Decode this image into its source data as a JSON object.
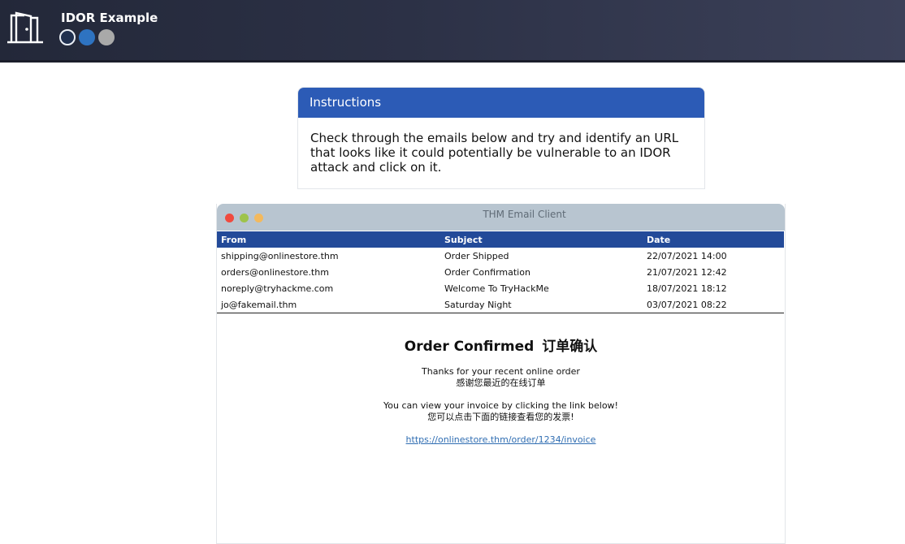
{
  "header": {
    "title": "IDOR Example",
    "logo_icon": "door-icon",
    "progress_dots": [
      "current",
      "active",
      "inactive"
    ]
  },
  "instructions": {
    "heading": "Instructions",
    "body": "Check through the emails below and try and identify an URL that looks like it could potentially be vulnerable to an IDOR attack and click on it."
  },
  "email_client": {
    "window_title": "THM Email Client",
    "columns": [
      "From",
      "Subject",
      "Date"
    ],
    "emails": [
      {
        "from": "shipping@onlinestore.thm",
        "subject": "Order Shipped",
        "date": "22/07/2021 14:00"
      },
      {
        "from": "orders@onlinestore.thm",
        "subject": "Order Confirmation",
        "date": "21/07/2021 12:42"
      },
      {
        "from": "noreply@tryhackme.com",
        "subject": "Welcome To TryHackMe",
        "date": "18/07/2021 18:12"
      },
      {
        "from": "jo@fakemail.thm",
        "subject": "Saturday Night",
        "date": "03/07/2021 08:22"
      }
    ],
    "message": {
      "title_en": "Order Confirmed",
      "title_zh": "订单确认",
      "line1_en": "Thanks for your recent online order",
      "line1_zh": "感谢您最近的在线订单",
      "line2_en": "You can view your invoice by clicking the link below!",
      "line2_zh": "您可以点击下面的链接查看您的发票!",
      "link": "https://onlinestore.thm/order/1234/invoice"
    }
  },
  "colors": {
    "topbar": "#2c3146",
    "instructions_header": "#2c5bb6",
    "table_header": "#234a99",
    "client_titlebar": "#b8c5d0",
    "link": "#2f6db2"
  }
}
